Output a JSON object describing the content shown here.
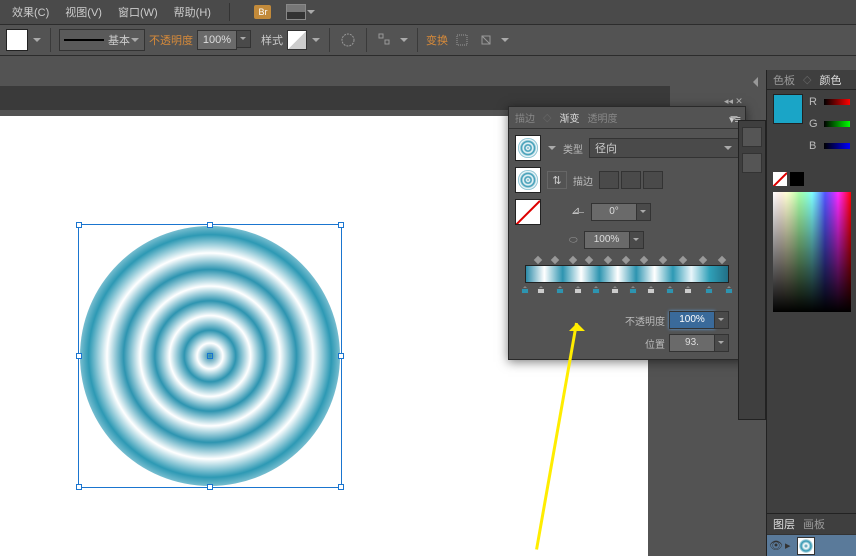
{
  "menubar": {
    "items": [
      "效果(C)",
      "视图(V)",
      "窗口(W)",
      "帮助(H)"
    ],
    "bridge": "Br"
  },
  "toolbar": {
    "stroke_label": "基本",
    "opacity_label": "不透明度",
    "opacity_value": "100%",
    "style_label": "样式",
    "transform_label": "变换"
  },
  "gradient_panel": {
    "tabs": [
      "描边",
      "渐变",
      "透明度"
    ],
    "active_tab": 1,
    "type_label": "类型",
    "type_value": "径向",
    "stroke_label": "描边",
    "angle_value": "0°",
    "aspect_value": "100%",
    "opacity_label": "不透明度",
    "opacity_value": "100%",
    "location_label": "位置",
    "location_value": "93.",
    "stops_diamond_pct": [
      5,
      13,
      22,
      30,
      39,
      48,
      57,
      66,
      76,
      86,
      95
    ],
    "stops_bottom": [
      {
        "pct": 0,
        "c": "teal"
      },
      {
        "pct": 8,
        "c": "w"
      },
      {
        "pct": 17,
        "c": "teal"
      },
      {
        "pct": 26,
        "c": "w"
      },
      {
        "pct": 35,
        "c": "teal"
      },
      {
        "pct": 44,
        "c": "w"
      },
      {
        "pct": 53,
        "c": "teal"
      },
      {
        "pct": 62,
        "c": "w"
      },
      {
        "pct": 71,
        "c": "teal"
      },
      {
        "pct": 80,
        "c": "w"
      },
      {
        "pct": 90,
        "c": "teal"
      },
      {
        "pct": 100,
        "c": "teal"
      }
    ]
  },
  "color_panel": {
    "tabs": [
      "色板",
      "颜色"
    ],
    "channels": [
      "R",
      "G",
      "B"
    ]
  },
  "layers_panel": {
    "tabs": [
      "图层",
      "画板"
    ]
  }
}
